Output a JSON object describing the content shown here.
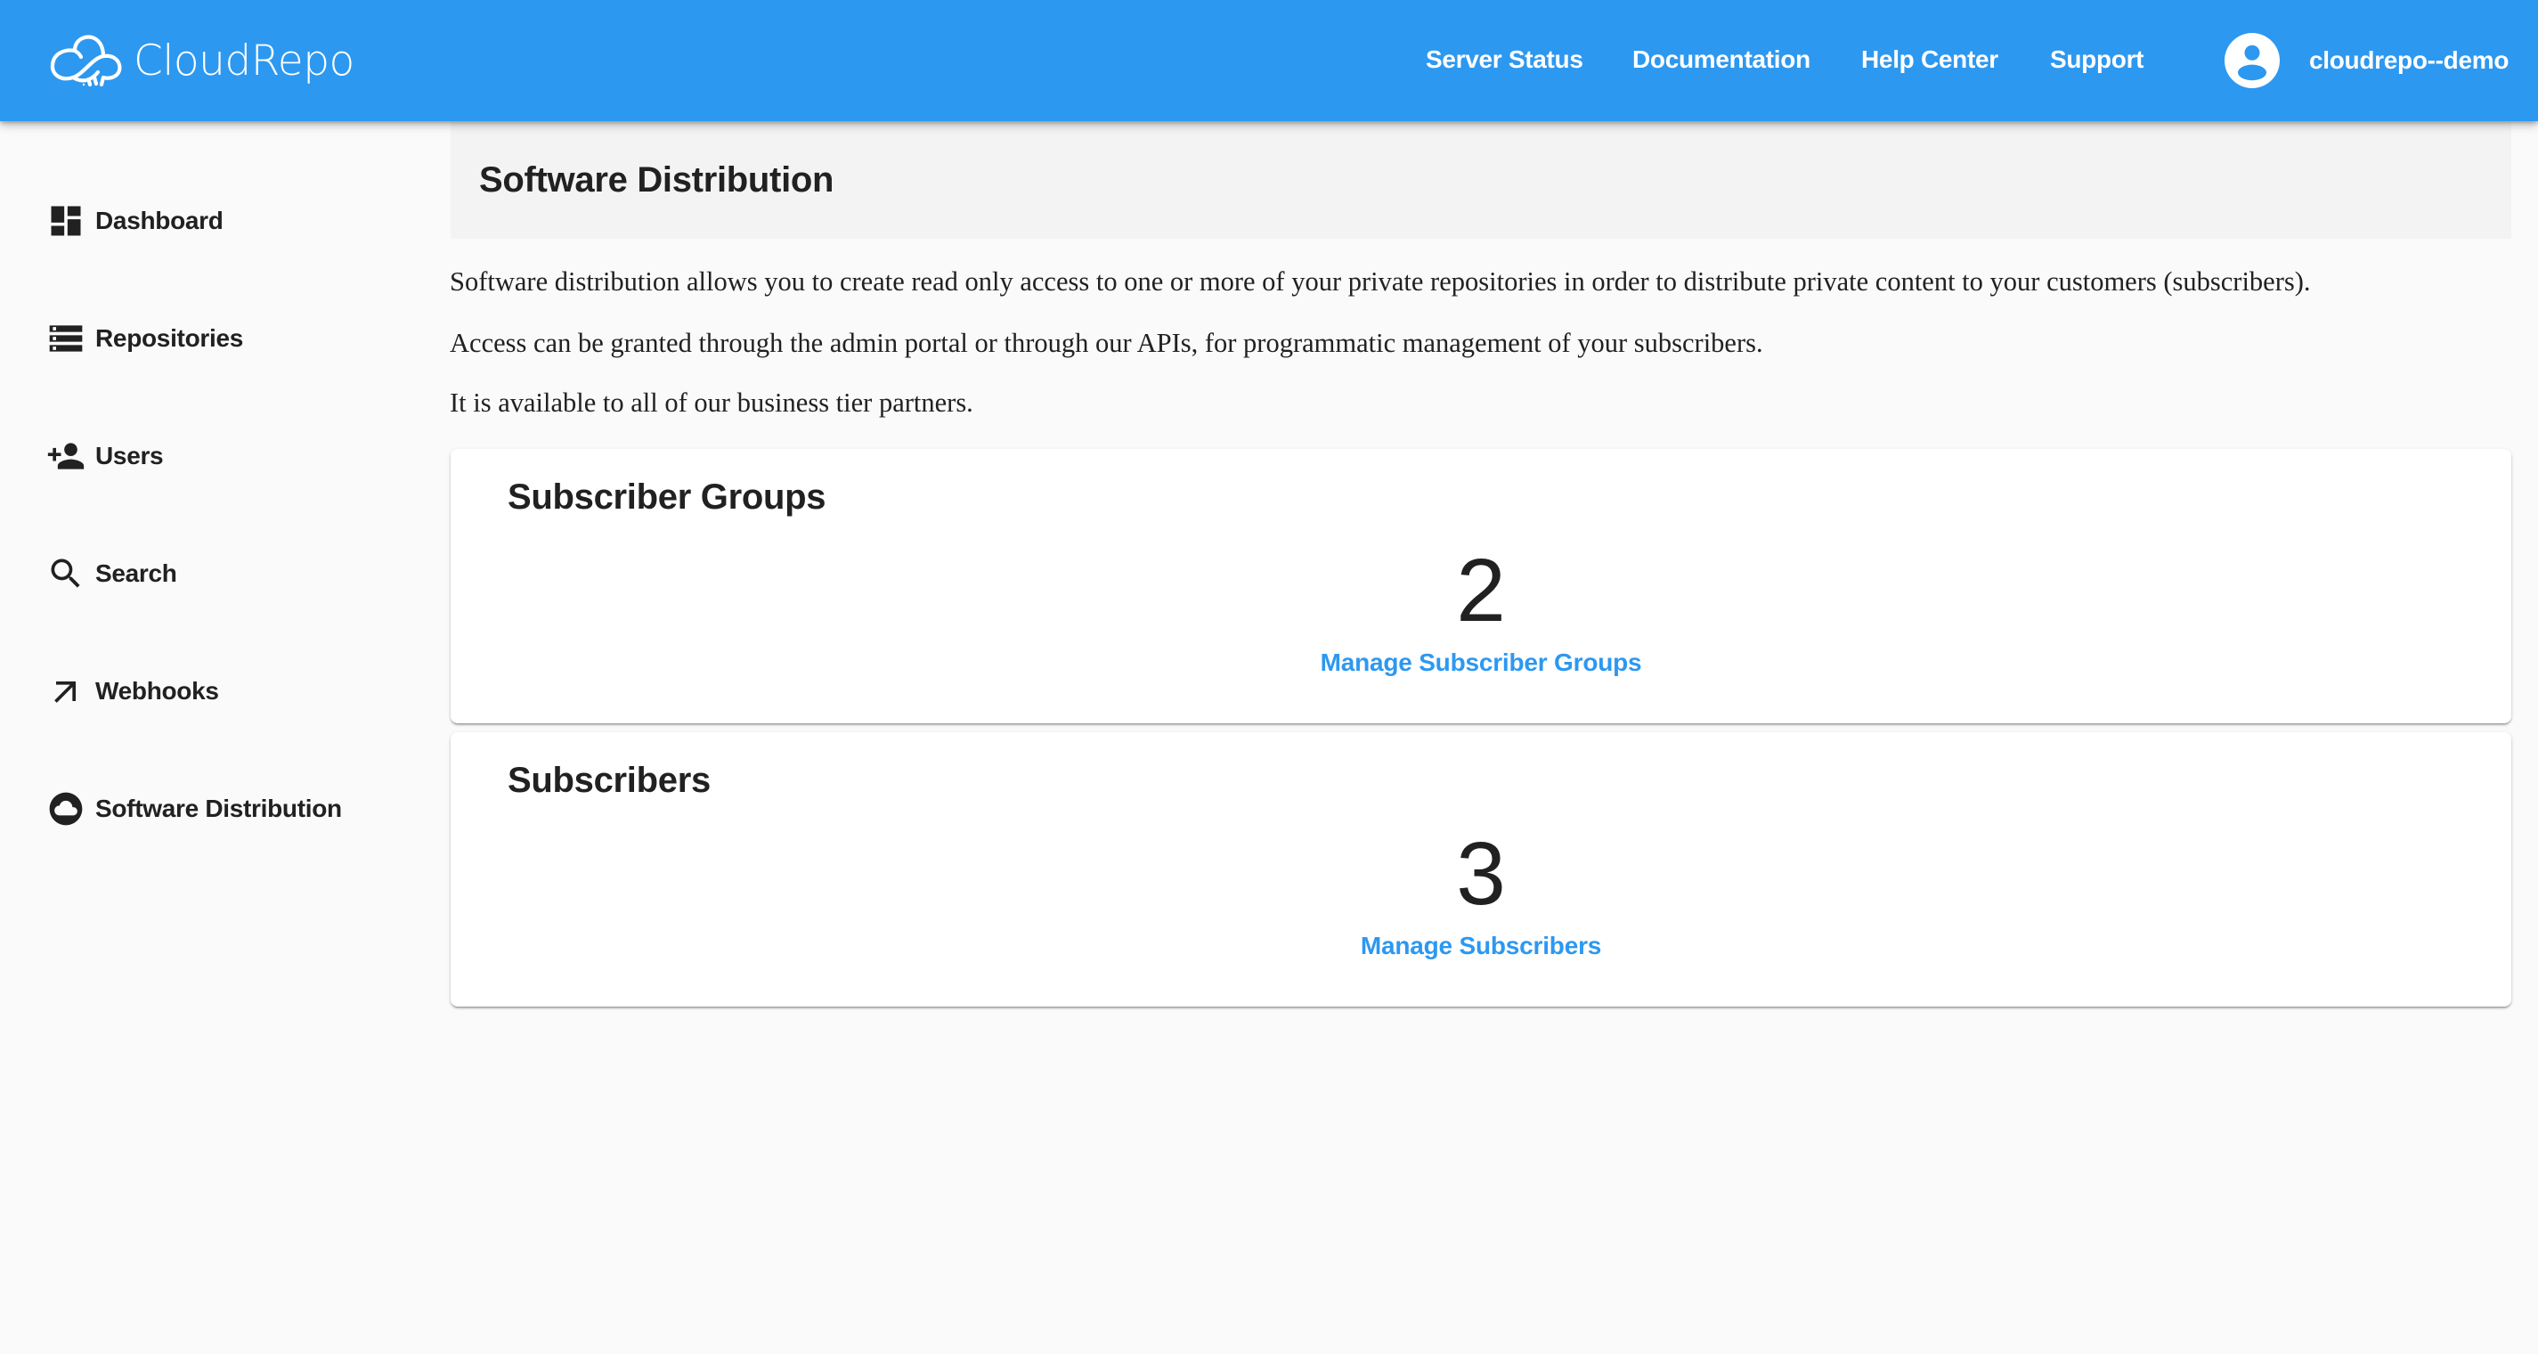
{
  "brand": {
    "name": "CloudRepo",
    "primary_color": "#2d98f0"
  },
  "header": {
    "nav": [
      {
        "label": "Server Status"
      },
      {
        "label": "Documentation"
      },
      {
        "label": "Help Center"
      },
      {
        "label": "Support"
      }
    ],
    "user": {
      "icon": "account-circle-icon",
      "name": "cloudrepo--demo"
    }
  },
  "sidebar": {
    "items": [
      {
        "label": "Dashboard",
        "icon": "dashboard-icon"
      },
      {
        "label": "Repositories",
        "icon": "storage-icon"
      },
      {
        "label": "Users",
        "icon": "person-add-icon"
      },
      {
        "label": "Search",
        "icon": "search-icon"
      },
      {
        "label": "Webhooks",
        "icon": "arrow-outward-icon"
      },
      {
        "label": "Software Distribution",
        "icon": "cloud-circle-icon"
      }
    ]
  },
  "main": {
    "title": "Software Distribution",
    "description": [
      "Software distribution allows you to create read only access to one or more of your private repositories in order to distribute private content to your customers (subscribers).",
      "Access can be granted through the admin portal or through our APIs, for programmatic management of your subscribers.",
      "It is available to all of our business tier partners."
    ],
    "cards": [
      {
        "title": "Subscriber Groups",
        "count": "2",
        "link": "Manage Subscriber Groups"
      },
      {
        "title": "Subscribers",
        "count": "3",
        "link": "Manage Subscribers"
      }
    ]
  }
}
